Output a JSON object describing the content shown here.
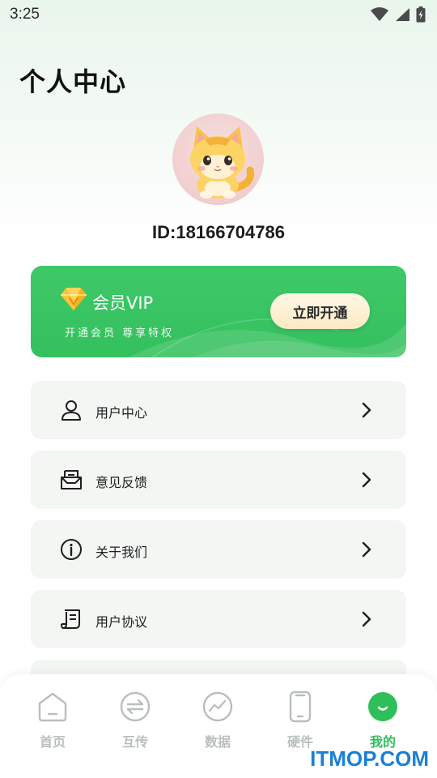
{
  "status_bar": {
    "time": "3:25",
    "icons": [
      "wifi-icon",
      "signal-icon",
      "battery-icon"
    ]
  },
  "page": {
    "title": "个人中心"
  },
  "profile": {
    "id_text": "ID:18166704786"
  },
  "vip": {
    "title": "会员VIP",
    "subtitle": "开通会员  尊享特权",
    "button_label": "立即开通",
    "accent_color": "#37c160"
  },
  "menu": {
    "items": [
      {
        "label": "用户中心",
        "icon": "user-icon"
      },
      {
        "label": "意见反馈",
        "icon": "feedback-icon"
      },
      {
        "label": "关于我们",
        "icon": "info-icon"
      },
      {
        "label": "用户协议",
        "icon": "document-icon"
      }
    ]
  },
  "tabs": [
    {
      "label": "首页",
      "icon": "home-icon",
      "active": false
    },
    {
      "label": "互传",
      "icon": "transfer-icon",
      "active": false
    },
    {
      "label": "数据",
      "icon": "chart-icon",
      "active": false
    },
    {
      "label": "硬件",
      "icon": "phone-icon",
      "active": false
    },
    {
      "label": "我的",
      "icon": "profile-icon",
      "active": true
    }
  ],
  "watermark": {
    "text": "ITMOP.COM",
    "color": "#1a7fd6"
  }
}
